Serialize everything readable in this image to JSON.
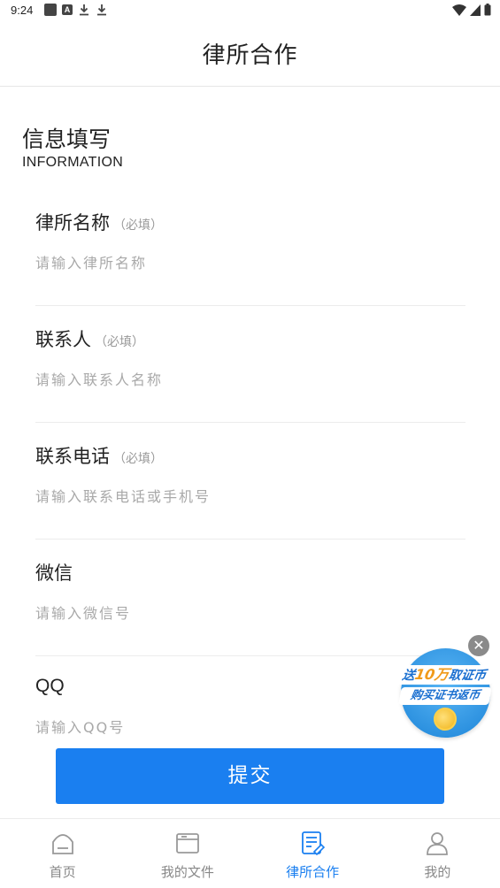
{
  "status_bar": {
    "time": "9:24",
    "left_icons": [
      "square-notification-icon",
      "a-notification-icon",
      "download-icon",
      "download-icon"
    ],
    "right_icons": [
      "wifi-icon",
      "signal-icon",
      "battery-icon"
    ]
  },
  "header": {
    "title": "律所合作"
  },
  "section": {
    "title": "信息填写",
    "subtitle": "INFORMATION"
  },
  "form": {
    "fields": [
      {
        "label": "律所名称",
        "required_text": "（必填）",
        "placeholder": "请输入律所名称",
        "value": ""
      },
      {
        "label": "联系人",
        "required_text": "（必填）",
        "placeholder": "请输入联系人名称",
        "value": ""
      },
      {
        "label": "联系电话",
        "required_text": "（必填）",
        "placeholder": "请输入联系电话或手机号",
        "value": ""
      },
      {
        "label": "微信",
        "required_text": "",
        "placeholder": "请输入微信号",
        "value": ""
      },
      {
        "label": "QQ",
        "required_text": "",
        "placeholder": "请输入QQ号",
        "value": ""
      }
    ],
    "submit_label": "提交"
  },
  "promo": {
    "line1_prefix": "送",
    "line1_highlight": "10万",
    "line1_suffix": "取证币",
    "line2": "购买证书返币",
    "close_icon": "close-icon"
  },
  "tab_bar": {
    "tabs": [
      {
        "label": "首页",
        "icon": "home-icon",
        "active": false
      },
      {
        "label": "我的文件",
        "icon": "folder-icon",
        "active": false
      },
      {
        "label": "律所合作",
        "icon": "document-edit-icon",
        "active": true
      },
      {
        "label": "我的",
        "icon": "user-icon",
        "active": false
      }
    ]
  },
  "colors": {
    "accent": "#1a7ff0",
    "placeholder": "#a9a9a9",
    "divider": "#ececec"
  }
}
